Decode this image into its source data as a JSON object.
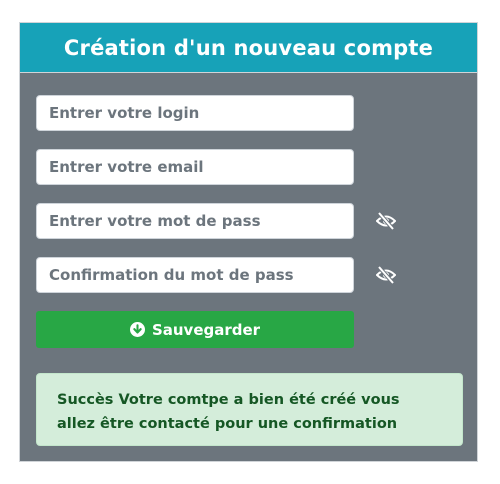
{
  "form": {
    "title": "Création d'un nouveau compte",
    "fields": {
      "login": {
        "placeholder": "Entrer votre login",
        "value": ""
      },
      "email": {
        "placeholder": "Entrer votre email",
        "value": ""
      },
      "password": {
        "placeholder": "Entrer votre mot de pass",
        "value": ""
      },
      "password_confirm": {
        "placeholder": "Confirmation du mot de pass",
        "value": ""
      }
    },
    "password_toggle_icon": "eye-slash-icon",
    "save_button": {
      "label": "Sauvegarder",
      "icon": "arrow-circle-down-icon"
    },
    "alert": {
      "message": "Succès Votre comtpe a bien été créé vous allez être contacté pour une confirmation"
    }
  },
  "colors": {
    "header_bg": "#17a2b8",
    "card_bg": "#6c757d",
    "button_bg": "#28a745",
    "alert_bg": "#d4edda",
    "alert_text": "#155724"
  }
}
